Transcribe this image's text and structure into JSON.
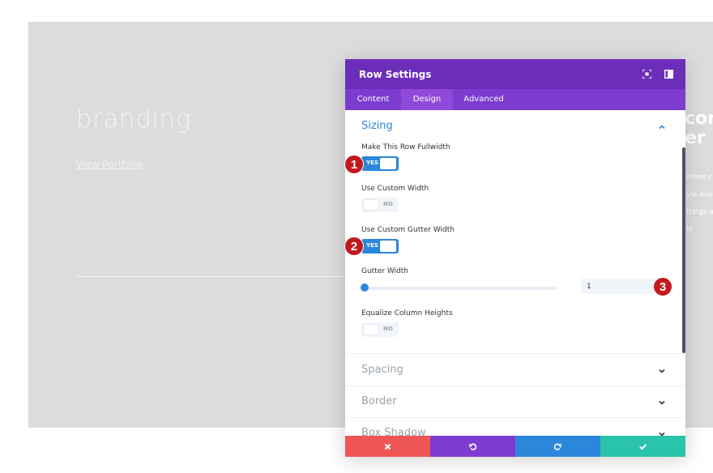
{
  "colors": {
    "header_bg": "#6c2eb9",
    "tabs_bg": "#7d3bcf",
    "active_tab_bg": "#8f4ad9",
    "accent_blue": "#2b87da",
    "marker_red": "#c3191e",
    "discard": "#ef5555",
    "undo": "#7e3bd0",
    "redo": "#2b87da",
    "save": "#29c4a9"
  },
  "background_page": {
    "heading": "branding",
    "link": "View Portfolio",
    "right_heading_line1": "con",
    "right_heading_line2": "er le",
    "right_text": [
      "inline c",
      "yle even",
      "ttings a",
      "lo"
    ]
  },
  "modal": {
    "title": "Row Settings",
    "header_icons": [
      "expand-icon",
      "sidebar-icon"
    ],
    "tabs": [
      {
        "label": "Content",
        "active": false
      },
      {
        "label": "Design",
        "active": true
      },
      {
        "label": "Advanced",
        "active": false
      }
    ],
    "sizing": {
      "title": "Sizing",
      "make_fullwidth": {
        "label": "Make This Row Fullwidth",
        "state": "YES"
      },
      "custom_width": {
        "label": "Use Custom Width",
        "state": "NO"
      },
      "custom_gutter": {
        "label": "Use Custom Gutter Width",
        "state": "YES"
      },
      "gutter_width": {
        "label": "Gutter Width",
        "value": "1",
        "fraction": 0.0
      },
      "equalize_heights": {
        "label": "Equalize Column Heights",
        "state": "NO"
      }
    },
    "groups": [
      "Spacing",
      "Border",
      "Box Shadow"
    ],
    "footer_icons": [
      "close-icon",
      "undo-icon",
      "redo-icon",
      "check-icon"
    ]
  },
  "markers": [
    "1",
    "2",
    "3"
  ]
}
